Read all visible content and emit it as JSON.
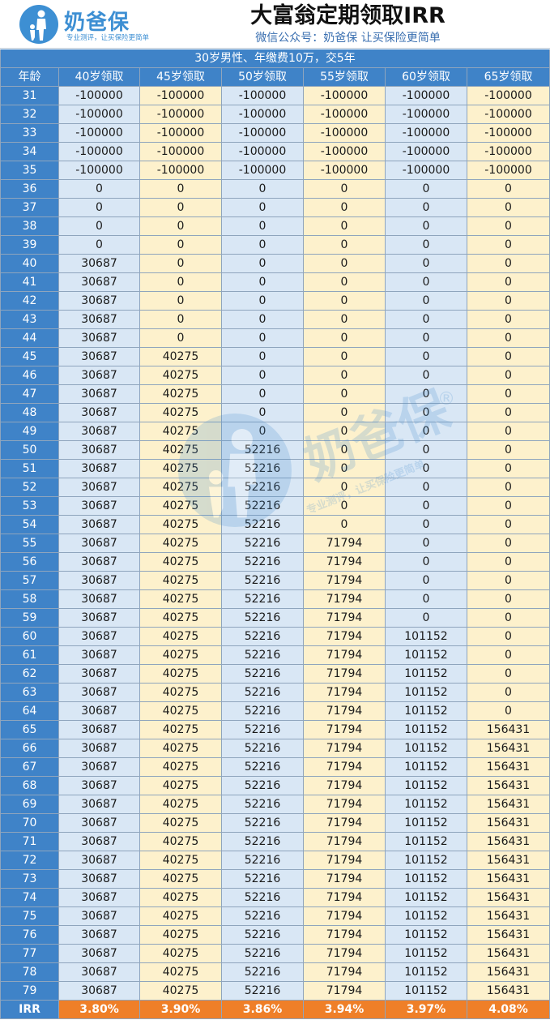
{
  "header": {
    "logo_text": "奶爸保",
    "logo_slogan": "专业测评，让买保险更简单",
    "title": "大富翁定期领取IRR",
    "subtitle": "微信公众号：奶爸保   让买保险更简单"
  },
  "watermark": {
    "text": "奶爸保",
    "slogan": "专业测评，让买保险更简单",
    "registered": "®"
  },
  "table": {
    "caption": "30岁男性、年缴费10万，交5年",
    "columns": [
      "年龄",
      "40岁领取",
      "45岁领取",
      "50岁领取",
      "55岁领取",
      "60岁领取",
      "65岁领取"
    ],
    "rows": [
      [
        "31",
        "-100000",
        "-100000",
        "-100000",
        "-100000",
        "-100000",
        "-100000"
      ],
      [
        "32",
        "-100000",
        "-100000",
        "-100000",
        "-100000",
        "-100000",
        "-100000"
      ],
      [
        "33",
        "-100000",
        "-100000",
        "-100000",
        "-100000",
        "-100000",
        "-100000"
      ],
      [
        "34",
        "-100000",
        "-100000",
        "-100000",
        "-100000",
        "-100000",
        "-100000"
      ],
      [
        "35",
        "-100000",
        "-100000",
        "-100000",
        "-100000",
        "-100000",
        "-100000"
      ],
      [
        "36",
        "0",
        "0",
        "0",
        "0",
        "0",
        "0"
      ],
      [
        "37",
        "0",
        "0",
        "0",
        "0",
        "0",
        "0"
      ],
      [
        "38",
        "0",
        "0",
        "0",
        "0",
        "0",
        "0"
      ],
      [
        "39",
        "0",
        "0",
        "0",
        "0",
        "0",
        "0"
      ],
      [
        "40",
        "30687",
        "0",
        "0",
        "0",
        "0",
        "0"
      ],
      [
        "41",
        "30687",
        "0",
        "0",
        "0",
        "0",
        "0"
      ],
      [
        "42",
        "30687",
        "0",
        "0",
        "0",
        "0",
        "0"
      ],
      [
        "43",
        "30687",
        "0",
        "0",
        "0",
        "0",
        "0"
      ],
      [
        "44",
        "30687",
        "0",
        "0",
        "0",
        "0",
        "0"
      ],
      [
        "45",
        "30687",
        "40275",
        "0",
        "0",
        "0",
        "0"
      ],
      [
        "46",
        "30687",
        "40275",
        "0",
        "0",
        "0",
        "0"
      ],
      [
        "47",
        "30687",
        "40275",
        "0",
        "0",
        "0",
        "0"
      ],
      [
        "48",
        "30687",
        "40275",
        "0",
        "0",
        "0",
        "0"
      ],
      [
        "49",
        "30687",
        "40275",
        "0",
        "0",
        "0",
        "0"
      ],
      [
        "50",
        "30687",
        "40275",
        "52216",
        "0",
        "0",
        "0"
      ],
      [
        "51",
        "30687",
        "40275",
        "52216",
        "0",
        "0",
        "0"
      ],
      [
        "52",
        "30687",
        "40275",
        "52216",
        "0",
        "0",
        "0"
      ],
      [
        "53",
        "30687",
        "40275",
        "52216",
        "0",
        "0",
        "0"
      ],
      [
        "54",
        "30687",
        "40275",
        "52216",
        "0",
        "0",
        "0"
      ],
      [
        "55",
        "30687",
        "40275",
        "52216",
        "71794",
        "0",
        "0"
      ],
      [
        "56",
        "30687",
        "40275",
        "52216",
        "71794",
        "0",
        "0"
      ],
      [
        "57",
        "30687",
        "40275",
        "52216",
        "71794",
        "0",
        "0"
      ],
      [
        "58",
        "30687",
        "40275",
        "52216",
        "71794",
        "0",
        "0"
      ],
      [
        "59",
        "30687",
        "40275",
        "52216",
        "71794",
        "0",
        "0"
      ],
      [
        "60",
        "30687",
        "40275",
        "52216",
        "71794",
        "101152",
        "0"
      ],
      [
        "61",
        "30687",
        "40275",
        "52216",
        "71794",
        "101152",
        "0"
      ],
      [
        "62",
        "30687",
        "40275",
        "52216",
        "71794",
        "101152",
        "0"
      ],
      [
        "63",
        "30687",
        "40275",
        "52216",
        "71794",
        "101152",
        "0"
      ],
      [
        "64",
        "30687",
        "40275",
        "52216",
        "71794",
        "101152",
        "0"
      ],
      [
        "65",
        "30687",
        "40275",
        "52216",
        "71794",
        "101152",
        "156431"
      ],
      [
        "66",
        "30687",
        "40275",
        "52216",
        "71794",
        "101152",
        "156431"
      ],
      [
        "67",
        "30687",
        "40275",
        "52216",
        "71794",
        "101152",
        "156431"
      ],
      [
        "68",
        "30687",
        "40275",
        "52216",
        "71794",
        "101152",
        "156431"
      ],
      [
        "69",
        "30687",
        "40275",
        "52216",
        "71794",
        "101152",
        "156431"
      ],
      [
        "70",
        "30687",
        "40275",
        "52216",
        "71794",
        "101152",
        "156431"
      ],
      [
        "71",
        "30687",
        "40275",
        "52216",
        "71794",
        "101152",
        "156431"
      ],
      [
        "72",
        "30687",
        "40275",
        "52216",
        "71794",
        "101152",
        "156431"
      ],
      [
        "73",
        "30687",
        "40275",
        "52216",
        "71794",
        "101152",
        "156431"
      ],
      [
        "74",
        "30687",
        "40275",
        "52216",
        "71794",
        "101152",
        "156431"
      ],
      [
        "75",
        "30687",
        "40275",
        "52216",
        "71794",
        "101152",
        "156431"
      ],
      [
        "76",
        "30687",
        "40275",
        "52216",
        "71794",
        "101152",
        "156431"
      ],
      [
        "77",
        "30687",
        "40275",
        "52216",
        "71794",
        "101152",
        "156431"
      ],
      [
        "78",
        "30687",
        "40275",
        "52216",
        "71794",
        "101152",
        "156431"
      ],
      [
        "79",
        "30687",
        "40275",
        "52216",
        "71794",
        "101152",
        "156431"
      ]
    ],
    "irr_row": [
      "IRR",
      "3.80%",
      "3.90%",
      "3.86%",
      "3.94%",
      "3.97%",
      "4.08%"
    ]
  },
  "colors": {
    "header_blue": "#3f83c8",
    "column_blue": "#d9e7f5",
    "column_cream": "#fdf1cc",
    "irr_orange": "#ef7f28",
    "logo_blue": "#3d8fd3"
  }
}
